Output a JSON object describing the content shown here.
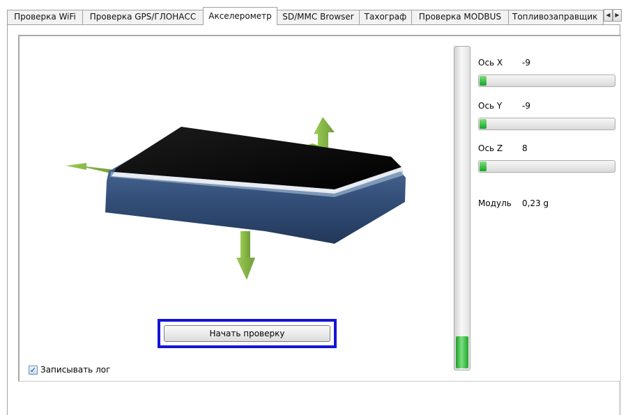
{
  "tabs": [
    {
      "label": "Проверка WiFi",
      "active": false
    },
    {
      "label": "Проверка GPS/ГЛОНАСС",
      "active": false
    },
    {
      "label": "Акселерометр",
      "active": true
    },
    {
      "label": "SD/MMC Browser",
      "active": false
    },
    {
      "label": "Тахограф",
      "active": false
    },
    {
      "label": "Проверка MODBUS",
      "active": false
    },
    {
      "label": "Топливозаправщик",
      "active": false
    }
  ],
  "tab_scroll": {
    "left_icon": "arrow-left-icon",
    "right_icon": "arrow-right-icon"
  },
  "axes": [
    {
      "label": "Ось X",
      "value": "-9",
      "level": 0.05
    },
    {
      "label": "Ось Y",
      "value": "-9",
      "level": 0.05
    },
    {
      "label": "Ось Z",
      "value": "8",
      "level": 0.05
    }
  ],
  "modulus": {
    "label": "Модуль",
    "value": "0,23 g"
  },
  "vertical_level": 0.1,
  "start_button": {
    "label": "Начать проверку"
  },
  "log_checkbox": {
    "label": "Записывать лог",
    "checked": true
  },
  "colors": {
    "device_top": "#000000",
    "device_side": "#3e5f85",
    "arrow": "#8fc14a",
    "progress": "#22a62e",
    "focus_frame": "#1414d8"
  }
}
